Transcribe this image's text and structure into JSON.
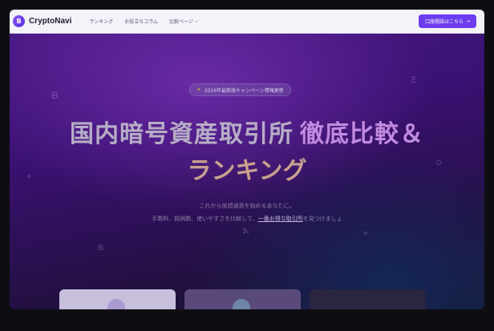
{
  "header": {
    "logo_mark": "B",
    "logo_text": "CryptoNavi",
    "nav": [
      {
        "label": "ランキング"
      },
      {
        "label": "お役立ちコラム"
      },
      {
        "label": "比較ページ"
      }
    ],
    "cta_label": "口座開設はこちら",
    "cta_arrow": "→"
  },
  "hero": {
    "badge_icon": "spark-icon",
    "badge_text": "2026年最新版キャンペーン情報更新",
    "title_part1": "国内暗号資産取引所",
    "title_part2": "徹底比較＆",
    "title_line2": "ランキング",
    "sub_line1": "これから仮想通貨を始めるあなたに。",
    "sub_line2_a": "手数料、銘柄数、使いやすさを比較して、",
    "sub_line2_hl": "一番お得な取引所",
    "sub_line2_b": "を見つけましょ",
    "sub_line3": "う。"
  },
  "deco": {
    "b": "B",
    "e": "Ξ"
  },
  "colors": {
    "accent": "#6b3cf0",
    "hero_bg": "#3a1172"
  }
}
